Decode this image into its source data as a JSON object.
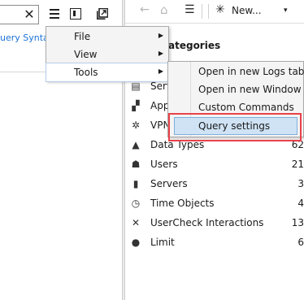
{
  "left_pane": {
    "search_clear_glyph": "✕",
    "query_syntax_link": "uery Syntax"
  },
  "toolbar": {
    "back_glyph": "←",
    "home_glyph": "⌂",
    "list_glyph": "☰",
    "new_label": "New...",
    "new_star_glyph": "✳",
    "caret": "▾"
  },
  "categories": {
    "title": "ategories",
    "items": [
      {
        "label": "Serv",
        "count": "",
        "icon": "server-icon",
        "glyph": "▤"
      },
      {
        "label": "App",
        "count": "",
        "icon": "applications-icon",
        "glyph": "▞"
      },
      {
        "label": "VPN",
        "count": "",
        "icon": "vpn-icon",
        "glyph": "✲"
      },
      {
        "label": "Data Types",
        "count": "62",
        "icon": "data-types-icon",
        "glyph": "▲"
      },
      {
        "label": "Users",
        "count": "21",
        "icon": "users-icon",
        "glyph": "☗"
      },
      {
        "label": "Servers",
        "count": "3",
        "icon": "servers-icon",
        "glyph": "▮"
      },
      {
        "label": "Time Objects",
        "count": "4",
        "icon": "time-objects-icon",
        "glyph": "◷"
      },
      {
        "label": "UserCheck Interactions",
        "count": "13",
        "icon": "usercheck-icon",
        "glyph": "✕"
      },
      {
        "label": "Limit",
        "count": "6",
        "icon": "limit-icon",
        "glyph": "●"
      }
    ]
  },
  "main_menu": {
    "items": [
      {
        "label": "File",
        "arrow": "▶"
      },
      {
        "label": "View",
        "arrow": "▶"
      },
      {
        "label": "Tools",
        "arrow": "▶"
      }
    ]
  },
  "tools_submenu": {
    "items": [
      {
        "label": "Open in new Logs tab"
      },
      {
        "label": "Open in new Window"
      },
      {
        "label": "Custom Commands"
      },
      {
        "label": "Query settings"
      }
    ]
  },
  "colors": {
    "highlight": "#cfe3f5",
    "annotation_frame": "#e8424a",
    "link": "#1a73d9"
  }
}
